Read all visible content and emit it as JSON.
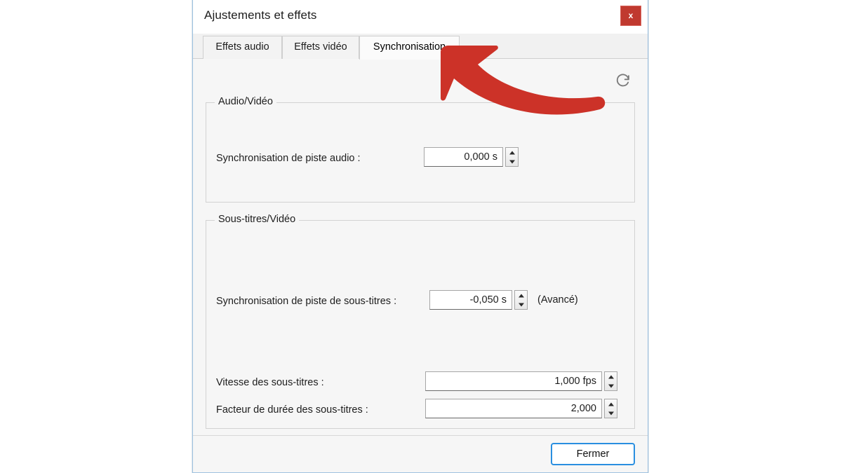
{
  "window": {
    "title": "Ajustements et effets",
    "close_icon": "close-x-icon",
    "close_label": "x"
  },
  "tabs": [
    {
      "label": "Effets audio",
      "active": false
    },
    {
      "label": "Effets vidéo",
      "active": false
    },
    {
      "label": "Synchronisation",
      "active": true
    }
  ],
  "toolbar": {
    "reset_icon": "refresh-icon"
  },
  "groups": [
    {
      "legend": "Audio/Vidéo",
      "fields": [
        {
          "label": "Synchronisation de piste audio :",
          "value": "0,000 s",
          "suffix": ""
        }
      ]
    },
    {
      "legend": "Sous-titres/Vidéo",
      "fields": [
        {
          "label": "Synchronisation de piste de sous-titres :",
          "value": "-0,050 s",
          "suffix": "(Avancé)"
        },
        {
          "label": "Vitesse des sous-titres :",
          "value": "1,000 fps",
          "suffix": ""
        },
        {
          "label": "Facteur de durée des sous-titres :",
          "value": "2,000",
          "suffix": ""
        }
      ]
    }
  ],
  "footer": {
    "close_button_label": "Fermer"
  },
  "annotation": {
    "arrow_color": "#cc3228",
    "arrow_name": "pointer-arrow"
  },
  "colors": {
    "accent_blue": "#2a8fe0",
    "close_red": "#c0392f",
    "dialog_bg": "#f6f6f6",
    "titlebar_bg": "#ffffff"
  }
}
